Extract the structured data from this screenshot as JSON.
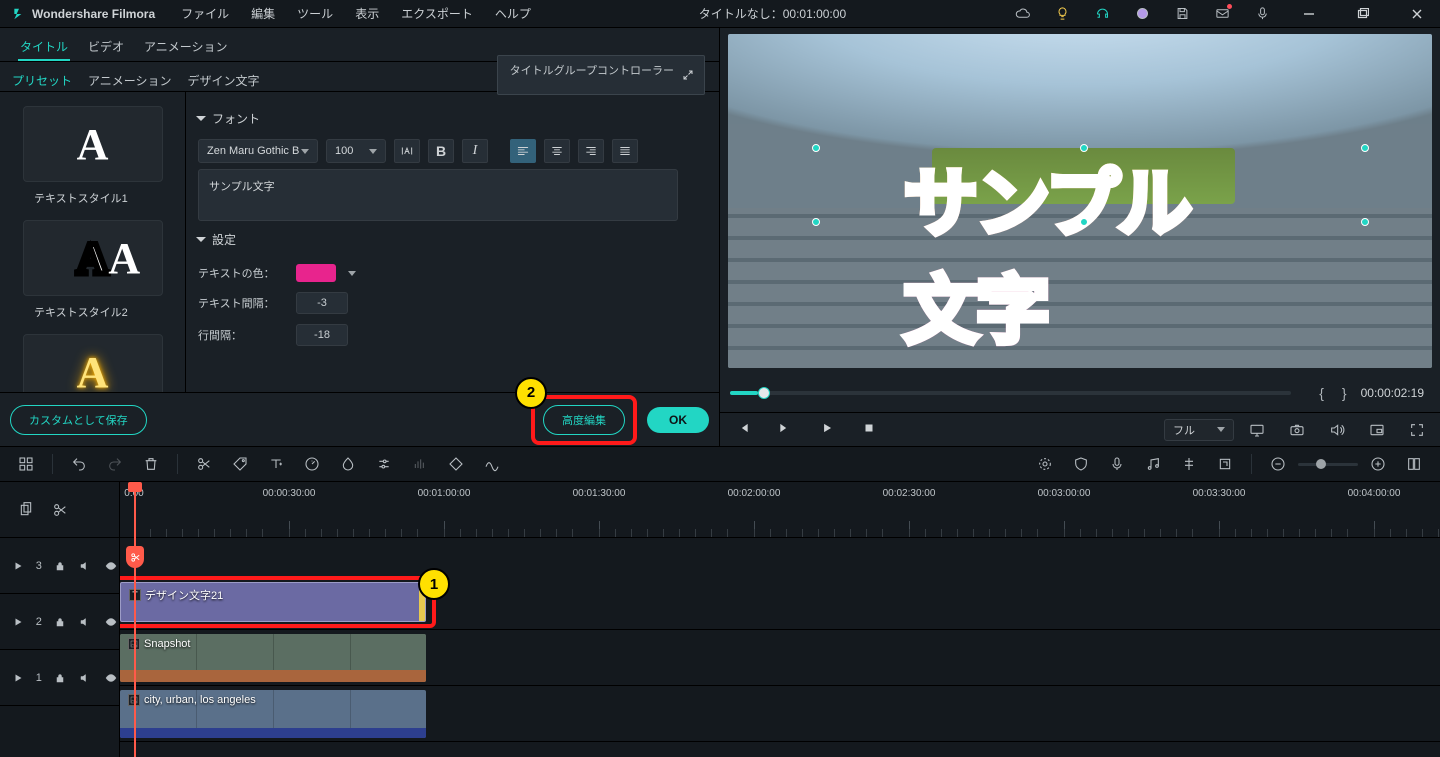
{
  "app": {
    "name": "Wondershare Filmora"
  },
  "menu": {
    "file": "ファイル",
    "edit": "編集",
    "tool": "ツール",
    "view": "表示",
    "export": "エクスポート",
    "help": "ヘルプ"
  },
  "title_center": "タイトルなし：00:01:00:00",
  "tabs1": {
    "title": "タイトル",
    "video": "ビデオ",
    "animation": "アニメーション"
  },
  "tgc_label": "タイトルグループコントローラー",
  "tabs2": {
    "preset": "プリセット",
    "animation": "アニメーション",
    "design": "デザイン文字"
  },
  "styles": {
    "s1": "テキストスタイル1",
    "s2": "テキストスタイル2"
  },
  "font_section": "フォント",
  "font": {
    "name": "Zen Maru Gothic B",
    "size": "100",
    "sample": "サンプル文字"
  },
  "settings_section": "設定",
  "settings": {
    "color_label": "テキストの色：",
    "text_spacing_label": "テキスト間隔：",
    "text_spacing": "-3",
    "line_spacing_label": "行間隔：",
    "line_spacing": "-18",
    "color": "#e8248d"
  },
  "buttons": {
    "save_custom": "カスタムとして保存",
    "advanced": "高度編集",
    "ok": "OK"
  },
  "annot": {
    "one": "1",
    "two": "2"
  },
  "preview_text": "サンプル文字",
  "timecode": "00:00:02:19",
  "quality": "フル",
  "ruler": [
    "0:00",
    "00:00:30:00",
    "00:01:00:00",
    "00:01:30:00",
    "00:02:00:00",
    "00:02:30:00",
    "00:03:00:00",
    "00:03:30:00",
    "00:04:00:00"
  ],
  "tracks": {
    "t3": "3",
    "t2": "2",
    "t1": "1"
  },
  "clips": {
    "title": "デザイン文字21",
    "snap": "Snapshot",
    "city": "city, urban, los angeles"
  }
}
